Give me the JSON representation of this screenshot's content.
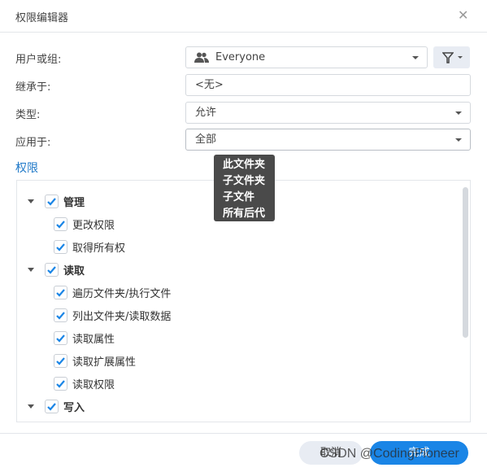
{
  "dialog": {
    "title": "权限编辑器",
    "close_icon": "close-icon"
  },
  "form": {
    "user_label": "用户或组:",
    "user_value": "Everyone",
    "user_icon": "users-icon",
    "inherit_label": "继承于:",
    "inherit_value": "<无>",
    "type_label": "类型:",
    "type_value": "允许",
    "apply_label": "应用于:",
    "apply_value": "全部",
    "filter_icon": "filter-icon"
  },
  "tooltip": {
    "lines": [
      "此文件夹",
      "子文件夹",
      "子文件",
      "所有后代"
    ]
  },
  "permissions": {
    "title": "权限",
    "groups": [
      {
        "label": "管理",
        "checked": true,
        "expanded": true,
        "items": [
          {
            "label": "更改权限",
            "checked": true
          },
          {
            "label": "取得所有权",
            "checked": true
          }
        ]
      },
      {
        "label": "读取",
        "checked": true,
        "expanded": true,
        "items": [
          {
            "label": "遍历文件夹/执行文件",
            "checked": true
          },
          {
            "label": "列出文件夹/读取数据",
            "checked": true
          },
          {
            "label": "读取属性",
            "checked": true
          },
          {
            "label": "读取扩展属性",
            "checked": true
          },
          {
            "label": "读取权限",
            "checked": true
          }
        ]
      },
      {
        "label": "写入",
        "checked": true,
        "expanded": true,
        "items": []
      }
    ]
  },
  "footer": {
    "cancel_label": "取消",
    "done_label": "完成"
  },
  "watermark": "CSDN @CodingPioneer",
  "colors": {
    "accent": "#1a85e6",
    "link": "#1e78c8"
  }
}
